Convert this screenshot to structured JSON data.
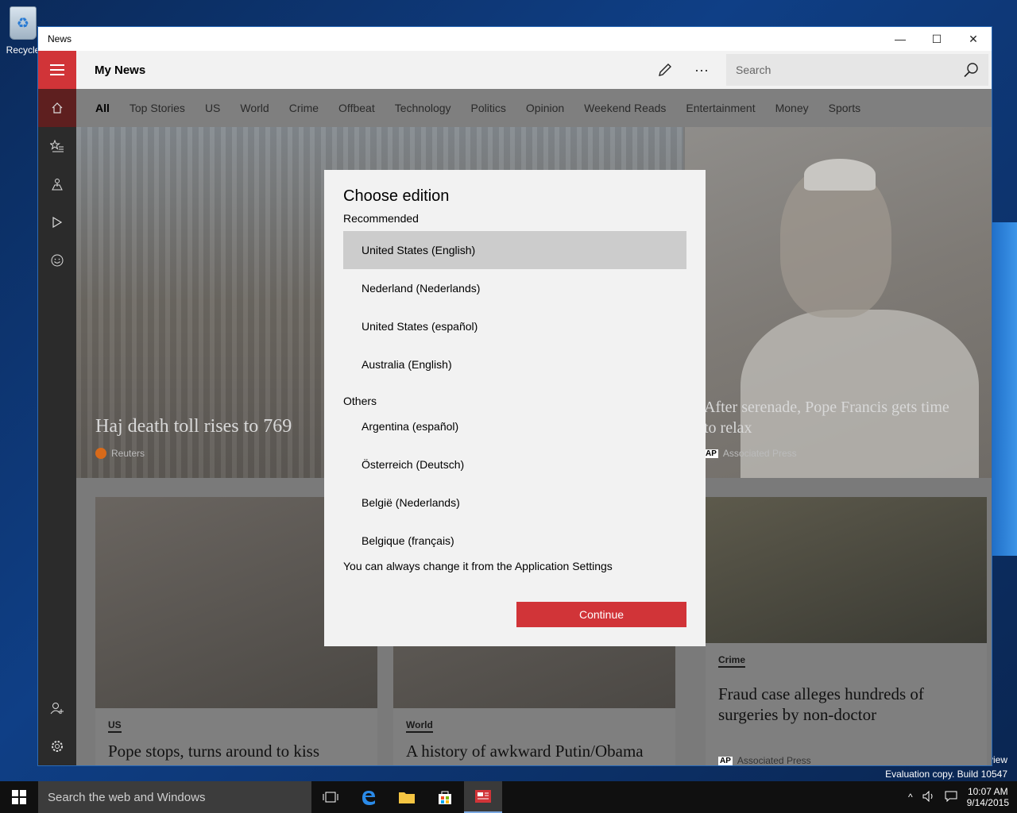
{
  "desktop": {
    "recycle_label": "Recycle",
    "watermark_preview": "eview",
    "watermark_build": "Evaluation copy. Build 10547"
  },
  "window": {
    "title": "News",
    "controls": {
      "minimize": "—",
      "maximize": "☐",
      "close": "✕"
    }
  },
  "appbar": {
    "title": "My News",
    "more_label": "···",
    "search_placeholder": "Search"
  },
  "tabs": [
    "All",
    "Top Stories",
    "US",
    "World",
    "Crime",
    "Offbeat",
    "Technology",
    "Politics",
    "Opinion",
    "Weekend Reads",
    "Entertainment",
    "Money",
    "Sports"
  ],
  "hero": {
    "left": {
      "title": "Haj death toll rises to 769",
      "source": "Reuters"
    },
    "right": {
      "title": "After serenade, Pope Francis gets time to relax",
      "source": "Associated Press",
      "source_badge": "AP"
    }
  },
  "cards": [
    {
      "category": "US",
      "headline": "Pope stops, turns around to kiss"
    },
    {
      "category": "World",
      "headline": "A history of awkward Putin/Obama"
    },
    {
      "category": "Crime",
      "headline": "Fraud case alleges hundreds of surgeries by non-doctor",
      "source": "Associated Press",
      "source_badge": "AP"
    }
  ],
  "dialog": {
    "title": "Choose edition",
    "recommended_label": "Recommended",
    "recommended": [
      "United States (English)",
      "Nederland (Nederlands)",
      "United States (español)",
      "Australia (English)"
    ],
    "others_label": "Others",
    "others": [
      "Argentina (español)",
      "Österreich (Deutsch)",
      "België (Nederlands)",
      "Belgique (français)"
    ],
    "note": "You can always change it from the Application Settings",
    "continue_label": "Continue",
    "selected_index": 0
  },
  "taskbar": {
    "search_text": "Search the web and Windows",
    "time": "10:07 AM",
    "date": "9/14/2015"
  },
  "colors": {
    "accent": "#d13438",
    "dialog_bg": "#f2f2f2",
    "selected_bg": "#cccccc"
  }
}
